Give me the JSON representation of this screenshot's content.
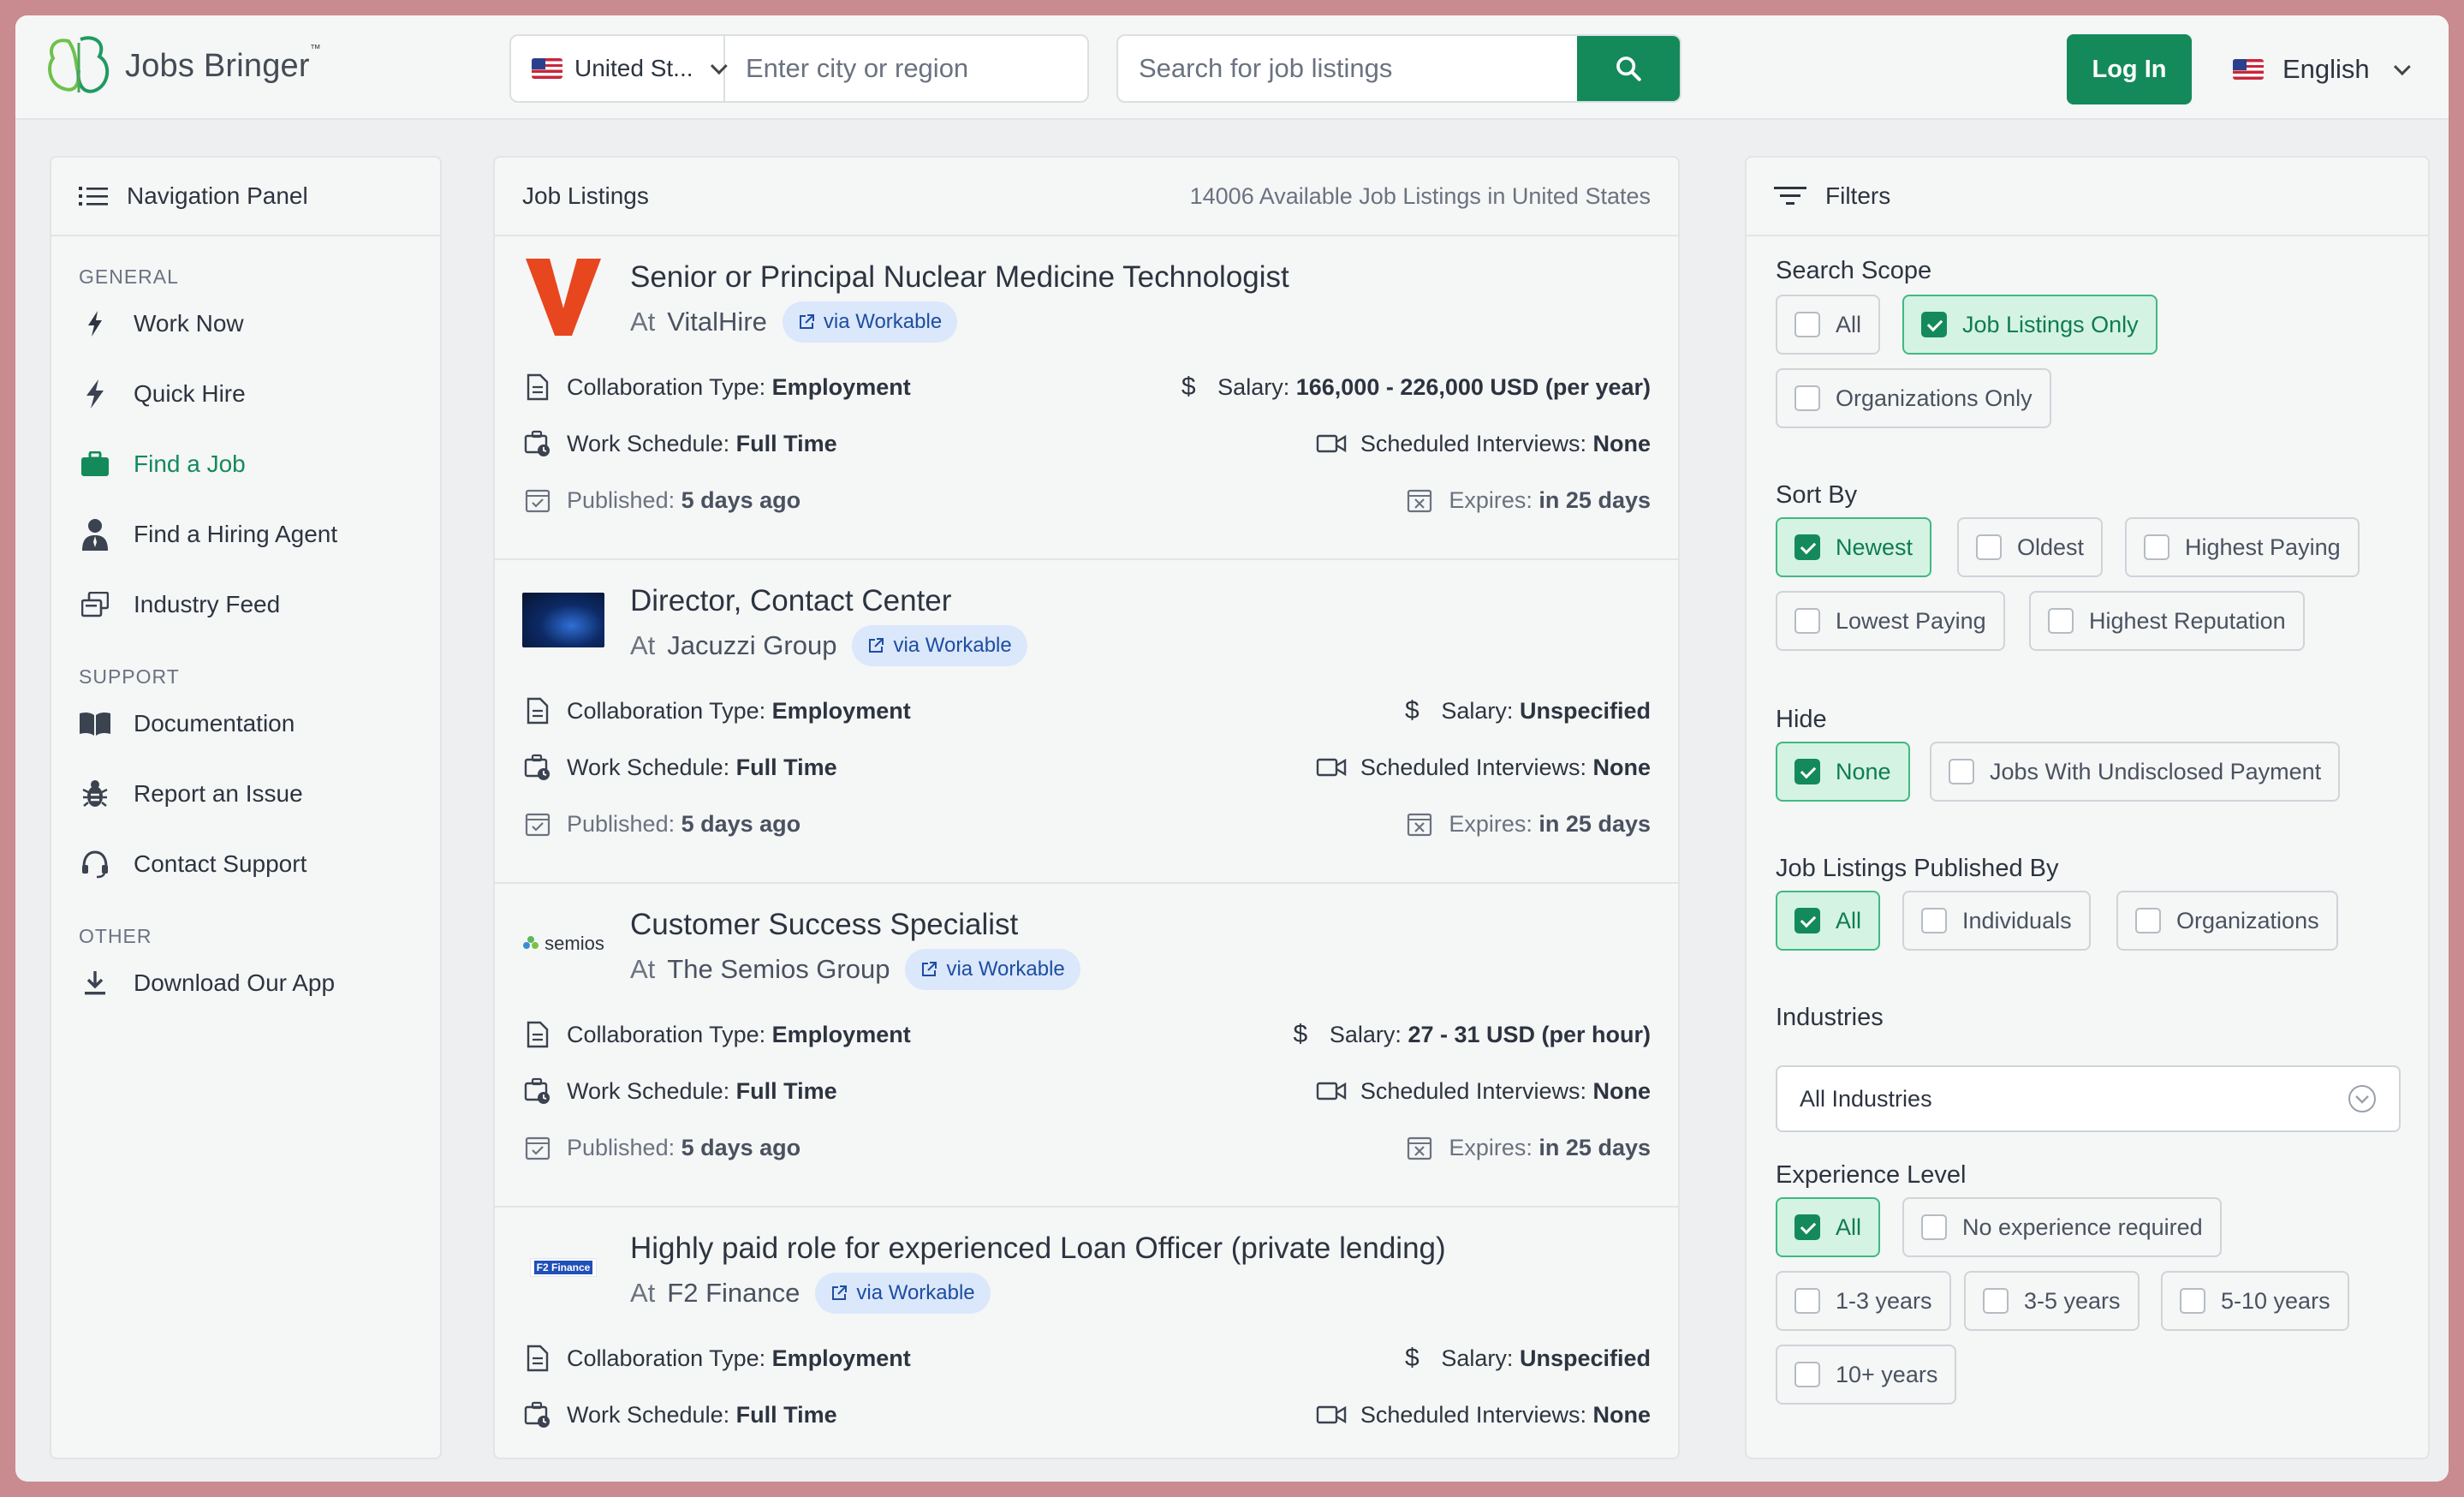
{
  "app": {
    "name": "Jobs Bringer",
    "trademark": "™",
    "accent_color": "#148a5b"
  },
  "header": {
    "country": "United St...",
    "city_placeholder": "Enter city or region",
    "search_placeholder": "Search for job listings",
    "login_label": "Log In",
    "language": "English"
  },
  "nav": {
    "title": "Navigation Panel",
    "sections": [
      {
        "label": "GENERAL",
        "items": [
          {
            "label": "Work Now",
            "icon": "bolt-icon"
          },
          {
            "label": "Quick Hire",
            "icon": "bolt-filled-icon"
          },
          {
            "label": "Find a Job",
            "icon": "briefcase-icon",
            "active": true
          },
          {
            "label": "Find a Hiring Agent",
            "icon": "agent-icon"
          },
          {
            "label": "Industry Feed",
            "icon": "feed-icon"
          }
        ]
      },
      {
        "label": "SUPPORT",
        "items": [
          {
            "label": "Documentation",
            "icon": "book-icon"
          },
          {
            "label": "Report an Issue",
            "icon": "bug-icon"
          },
          {
            "label": "Contact Support",
            "icon": "headset-icon"
          }
        ]
      },
      {
        "label": "OTHER",
        "items": [
          {
            "label": "Download Our App",
            "icon": "download-icon"
          }
        ]
      }
    ]
  },
  "listings": {
    "title": "Job Listings",
    "count_text": "14006 Available Job Listings in United States",
    "labels": {
      "at": "At",
      "collab": "Collaboration Type:",
      "salary": "Salary:",
      "schedule": "Work Schedule:",
      "interviews": "Scheduled Interviews:",
      "published": "Published:",
      "expires": "Expires:"
    },
    "jobs": [
      {
        "title": "Senior or Principal Nuclear Medicine Technologist",
        "company": "VitalHire",
        "source": "via Workable",
        "collab": "Employment",
        "salary": "166,000 - 226,000 USD (per year)",
        "schedule": "Full Time",
        "interviews": "None",
        "published": "5 days ago",
        "expires": "in 25 days",
        "logo": "vitalhire-logo"
      },
      {
        "title": "Director, Contact Center",
        "company": "Jacuzzi Group",
        "source": "via Workable",
        "collab": "Employment",
        "salary": "Unspecified",
        "schedule": "Full Time",
        "interviews": "None",
        "published": "5 days ago",
        "expires": "in 25 days",
        "logo": "jacuzzi-logo"
      },
      {
        "title": "Customer Success Specialist",
        "company": "The Semios Group",
        "source": "via Workable",
        "collab": "Employment",
        "salary": "27 - 31 USD (per hour)",
        "schedule": "Full Time",
        "interviews": "None",
        "published": "5 days ago",
        "expires": "in 25 days",
        "logo": "semios-logo",
        "logo_text": "semios"
      },
      {
        "title": "Highly paid role for experienced Loan Officer (private lending)",
        "company": "F2 Finance",
        "source": "via Workable",
        "collab": "Employment",
        "salary": "Unspecified",
        "schedule": "Full Time",
        "interviews": "None",
        "logo": "f2finance-logo",
        "logo_text": "F2 Finance"
      }
    ]
  },
  "filters": {
    "title": "Filters",
    "search_scope": {
      "title": "Search Scope",
      "options": [
        {
          "label": "All",
          "checked": false
        },
        {
          "label": "Job Listings Only",
          "checked": true
        },
        {
          "label": "Organizations Only",
          "checked": false
        }
      ]
    },
    "sort_by": {
      "title": "Sort By",
      "options": [
        {
          "label": "Newest",
          "checked": true
        },
        {
          "label": "Oldest",
          "checked": false
        },
        {
          "label": "Highest Paying",
          "checked": false
        },
        {
          "label": "Lowest Paying",
          "checked": false
        },
        {
          "label": "Highest Reputation",
          "checked": false
        }
      ]
    },
    "hide": {
      "title": "Hide",
      "options": [
        {
          "label": "None",
          "checked": true
        },
        {
          "label": "Jobs With Undisclosed Payment",
          "checked": false
        }
      ]
    },
    "published_by": {
      "title": "Job Listings Published By",
      "options": [
        {
          "label": "All",
          "checked": true
        },
        {
          "label": "Individuals",
          "checked": false
        },
        {
          "label": "Organizations",
          "checked": false
        }
      ]
    },
    "industries": {
      "title": "Industries",
      "value": "All Industries"
    },
    "experience": {
      "title": "Experience Level",
      "options": [
        {
          "label": "All",
          "checked": true
        },
        {
          "label": "No experience required",
          "checked": false
        },
        {
          "label": "1-3 years",
          "checked": false
        },
        {
          "label": "3-5 years",
          "checked": false
        },
        {
          "label": "5-10 years",
          "checked": false
        },
        {
          "label": "10+ years",
          "checked": false
        }
      ]
    }
  }
}
